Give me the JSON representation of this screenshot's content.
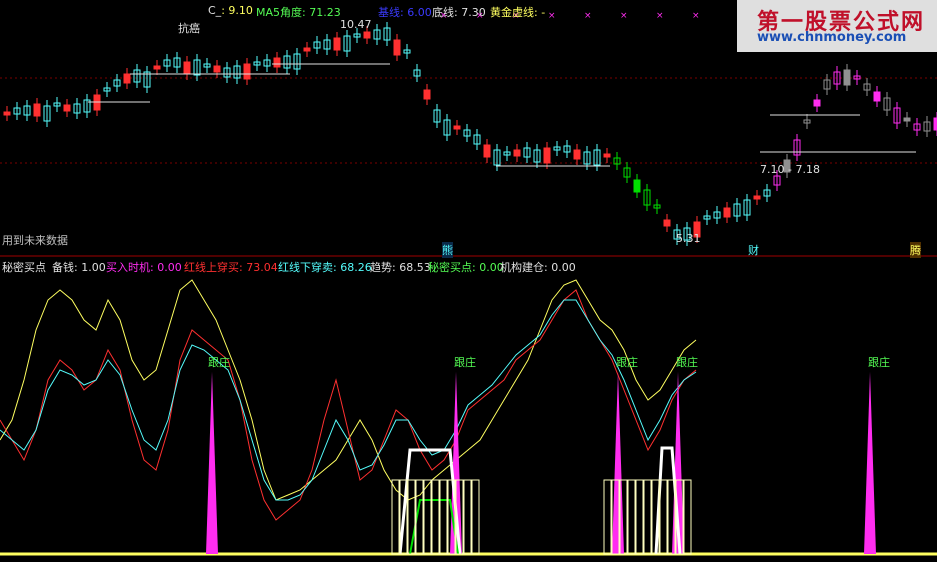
{
  "top_panel": {
    "info_bar": {
      "c_label": "C_",
      "c_value": ": 9.10",
      "ma5_label": "MA5角度: 71.23",
      "x_marker": "基线: 6.00",
      "bottom_line": "底线: 7.30",
      "gold_line": "黄金虚线: -"
    },
    "chip_label": "抗癌",
    "high_label": "10.47",
    "future_hint": "用到未来数据",
    "range_label": "7.10 - 7.18",
    "low_label": "5.31",
    "axis_tags": [
      "熊",
      "财",
      "腾"
    ]
  },
  "bottom_panel": {
    "info_bar": {
      "name": "秘密买点",
      "f1": "备钱: 1.00",
      "f2": "买入时机: 0.00",
      "f3": "红线上穿买: 73.04",
      "f4": "红线下穿卖: 68.26",
      "f5": "趋势: 68.53",
      "f6": "秘密买点: 0.00",
      "f7": "机构建仓: 0.00"
    },
    "signal_label": "跟庄"
  },
  "watermark": {
    "title": "第一股票公式网",
    "url": "www.chnmoney.com"
  },
  "colors": {
    "red": "#ff3030",
    "cyan": "#54fcfc",
    "green": "#00e000",
    "magenta": "#ff2df0",
    "yellow": "#ffff60",
    "white": "#ffffff",
    "gray": "#909090",
    "grid": "#8b0000"
  }
}
